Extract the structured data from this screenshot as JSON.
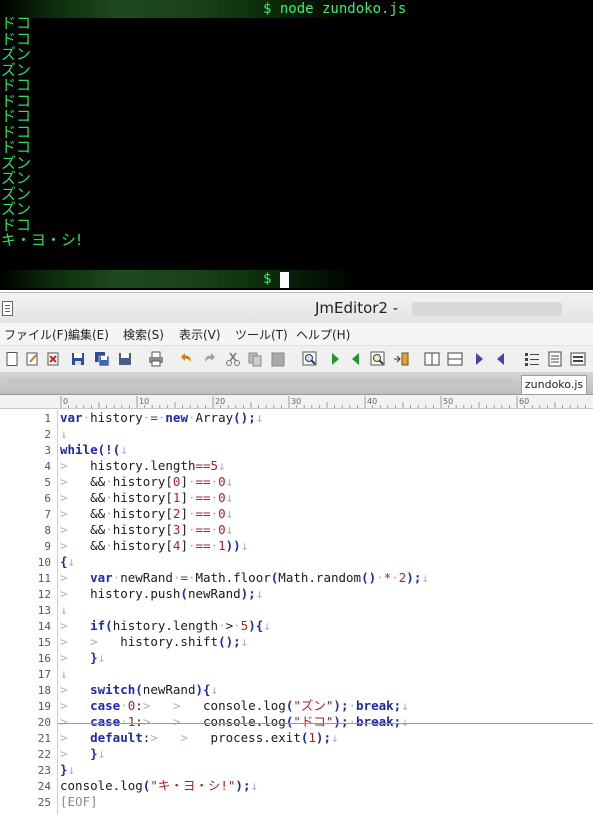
{
  "terminal": {
    "command_prompt": "$ node zundoko.js",
    "output_lines": [
      "ドコ",
      "ドコ",
      "ズン",
      "ズン",
      "ドコ",
      "ドコ",
      "ドコ",
      "ドコ",
      "ドコ",
      "ズン",
      "ズン",
      "ズン",
      "ズン",
      "ドコ",
      "キ・ヨ・シ!"
    ],
    "end_prompt": "$"
  },
  "editor": {
    "title": "JmEditor2 -",
    "menu": [
      "ファイル(F)",
      "編集(E)",
      "検索(S)",
      "表示(V)",
      "ツール(T)",
      "ヘルプ(H)"
    ],
    "toolbar_icons": [
      "new-file-icon",
      "open-file-icon",
      "close-file-icon",
      "save-icon",
      "save-all-icon",
      "save-as-icon",
      "print-icon",
      "undo-icon",
      "redo-icon",
      "cut-icon",
      "copy-icon",
      "paste-icon",
      "find-icon",
      "find-next-icon",
      "find-prev-icon",
      "replace-icon",
      "jump-icon",
      "split-horizontal-icon",
      "split-vertical-icon",
      "next-window-icon",
      "prev-window-icon",
      "list-icon",
      "properties-icon",
      "settings-icon"
    ],
    "active_tab": "zundoko.js",
    "ruler_labels": [
      "0",
      "10",
      "20",
      "30",
      "40",
      "50",
      "60"
    ],
    "line_numbers": [
      "1",
      "2",
      "3",
      "4",
      "5",
      "6",
      "7",
      "8",
      "9",
      "10",
      "11",
      "12",
      "13",
      "14",
      "15",
      "16",
      "17",
      "18",
      "19",
      "20",
      "21",
      "22",
      "23",
      "24",
      "25"
    ],
    "code_lines": [
      "var history = new Array();",
      "",
      "while(!(",
      "\thistory.length==5",
      "\t&& history[0] == 0",
      "\t&& history[1] == 0",
      "\t&& history[2] == 0",
      "\t&& history[3] == 0",
      "\t&& history[4] == 1))",
      "{",
      "\tvar newRand = Math.floor(Math.random() * 2);",
      "\thistory.push(newRand);",
      "",
      "\tif(history.length > 5){",
      "\t\thistory.shift();",
      "\t}",
      "",
      "\tswitch(newRand){",
      "\tcase 0:\t\tconsole.log(\"ズン\"); break;",
      "\tcase 1:\t\tconsole.log(\"ドコ\"); break;",
      "\tdefault:\t\tprocess.exit(1);",
      "\t}",
      "}",
      "console.log(\"キ・ヨ・シ!\");",
      "[EOF]"
    ],
    "colors": {
      "keyword": "#1e2aa8",
      "literal": "#b01e1e",
      "whitespace_marker": "#aab0c8",
      "terminal_text": "#2ce05a"
    }
  }
}
